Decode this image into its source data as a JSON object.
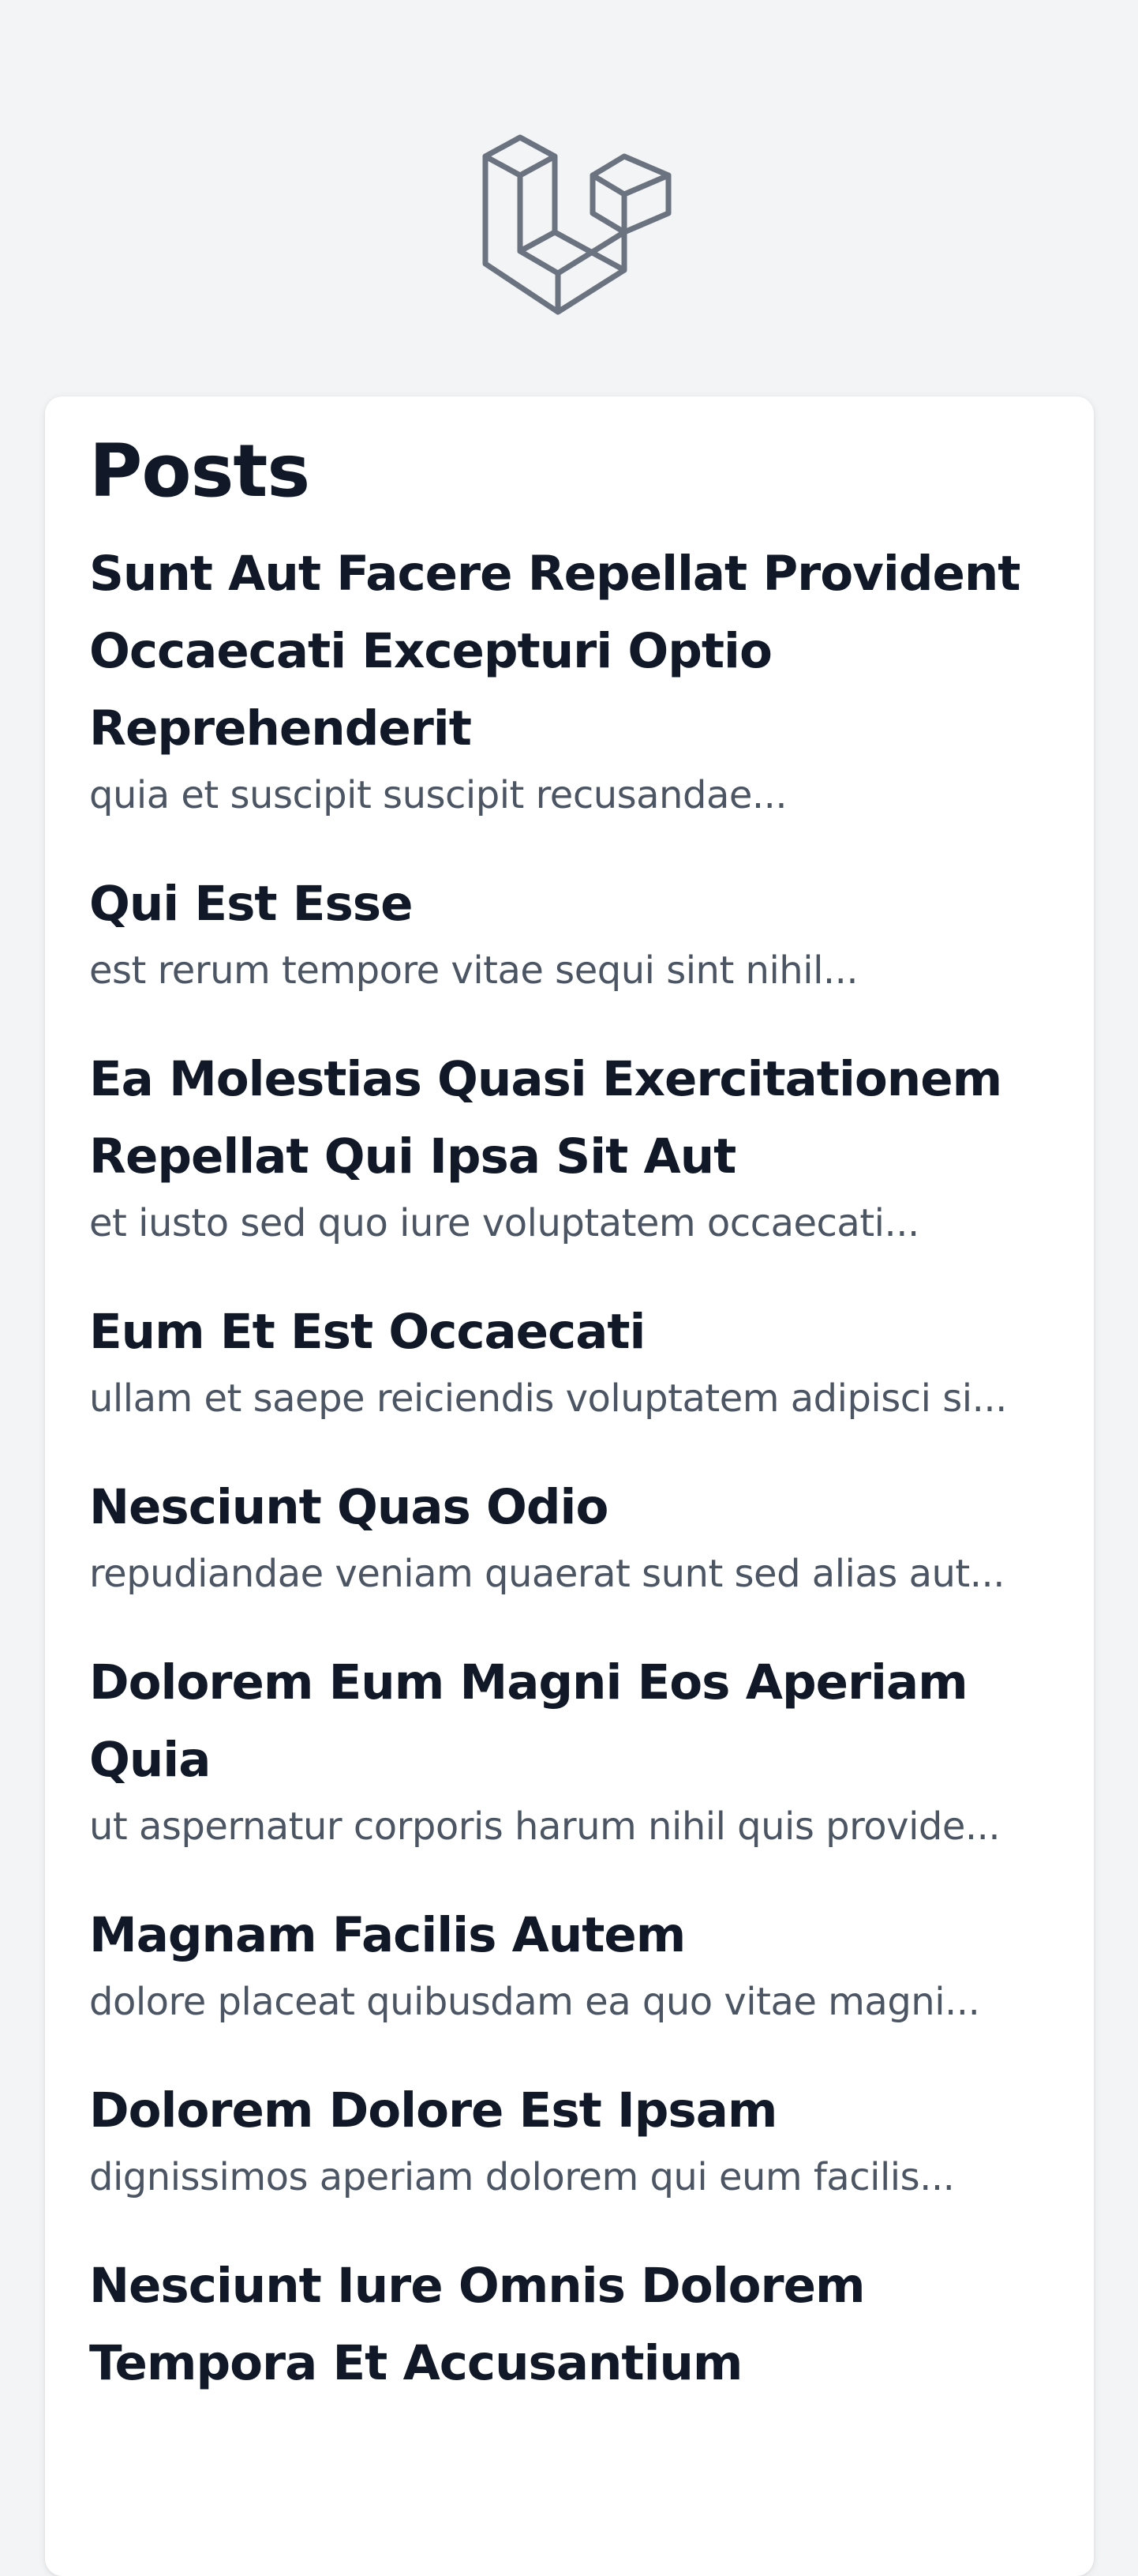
{
  "header": {
    "logo_icon": "laravel-logo-icon",
    "logo_color": "#6b7280"
  },
  "main": {
    "title": "Posts",
    "posts": [
      {
        "title": "Sunt Aut Facere Repellat Provident Occaecati Excepturi Optio Reprehenderit",
        "excerpt": "quia et suscipit suscipit recusandae..."
      },
      {
        "title": "Qui Est Esse",
        "excerpt": "est rerum tempore vitae sequi sint nihil..."
      },
      {
        "title": "Ea Molestias Quasi Exercitationem Repellat Qui Ipsa Sit Aut",
        "excerpt": "et iusto sed quo iure voluptatem occaecati..."
      },
      {
        "title": "Eum Et Est Occaecati",
        "excerpt": "ullam et saepe reiciendis voluptatem adipisci si..."
      },
      {
        "title": "Nesciunt Quas Odio",
        "excerpt": "repudiandae veniam quaerat sunt sed alias aut..."
      },
      {
        "title": "Dolorem Eum Magni Eos Aperiam Quia",
        "excerpt": "ut aspernatur corporis harum nihil quis provide..."
      },
      {
        "title": "Magnam Facilis Autem",
        "excerpt": "dolore placeat quibusdam ea quo vitae magni..."
      },
      {
        "title": "Dolorem Dolore Est Ipsam",
        "excerpt": "dignissimos aperiam dolorem qui eum facilis..."
      },
      {
        "title": "Nesciunt Iure Omnis Dolorem Tempora Et Accusantium",
        "excerpt": ""
      }
    ]
  },
  "colors": {
    "background": "#f3f4f6",
    "card": "#ffffff",
    "title_text": "#111827",
    "excerpt_text": "#4b5563"
  }
}
